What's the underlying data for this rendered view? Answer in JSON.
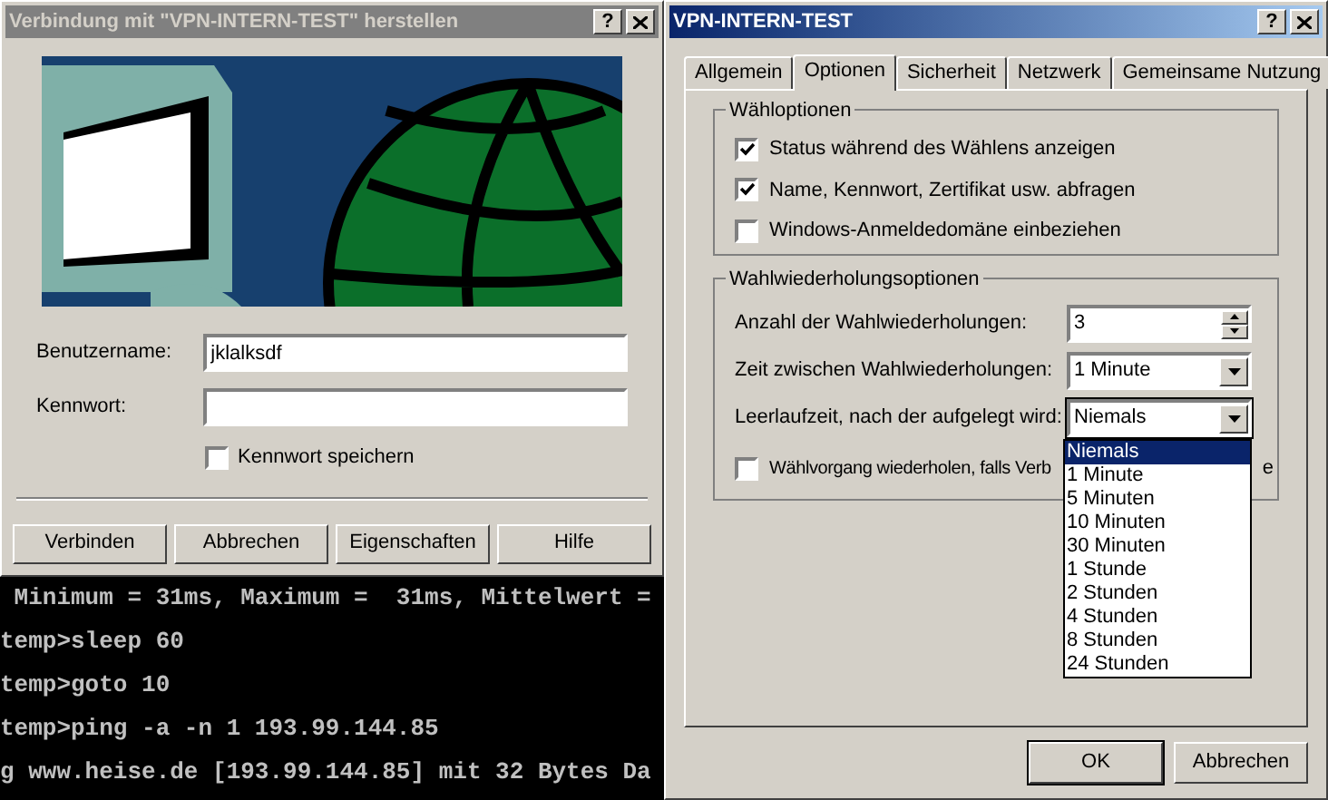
{
  "login_dialog": {
    "title": "Verbindung mit \"VPN-INTERN-TEST\" herstellen",
    "help_button": "?",
    "fields": [
      {
        "label": "Benutzername:",
        "value": "jklalksdf"
      },
      {
        "label": "Kennwort:"
      }
    ],
    "save_password": {
      "label": "Kennwort speichern",
      "checked": false
    },
    "buttons": [
      "Verbinden",
      "Abbrechen",
      "Eigenschaften",
      "Hilfe"
    ]
  },
  "console": {
    "lines": [
      " Minimum = 31ms, Maximum =  31ms, Mittelwert =",
      "temp>sleep 60",
      "temp>goto 10",
      "temp>ping -a -n 1 193.99.144.85",
      "g www.heise.de [193.99.144.85] mit 32 Bytes Da"
    ]
  },
  "properties_dialog": {
    "title": "VPN-INTERN-TEST",
    "help_button": "?",
    "tabs": [
      {
        "label": "Allgemein",
        "selected": false
      },
      {
        "label": "Optionen",
        "selected": true
      },
      {
        "label": "Sicherheit",
        "selected": false
      },
      {
        "label": "Netzwerk",
        "selected": false
      },
      {
        "label": "Gemeinsame Nutzung",
        "selected": false
      }
    ],
    "dial_options": {
      "title": "Wähloptionen",
      "checkboxes": [
        {
          "label": "Status während des Wählens anzeigen",
          "checked": true
        },
        {
          "label": "Name, Kennwort, Zertifikat usw. abfragen",
          "checked": true
        },
        {
          "label": "Windows-Anmeldedomäne einbeziehen",
          "checked": false
        }
      ]
    },
    "redial_options": {
      "title": "Wahlwiederholungsoptionen",
      "rows": [
        {
          "kind": "spinner",
          "label": "Anzahl der Wahlwiederholungen:",
          "value": "3"
        },
        {
          "kind": "dropdown",
          "label": "Zeit zwischen Wahlwiederholungen:",
          "value": "1 Minute",
          "expanded": false
        },
        {
          "kind": "dropdown",
          "label": "Leerlaufzeit, nach der aufgelegt wird:",
          "value": "Niemals",
          "expanded": true,
          "options": [
            {
              "label": "Niemals",
              "selected": true
            },
            {
              "label": "1 Minute",
              "selected": false
            },
            {
              "label": "5 Minuten",
              "selected": false
            },
            {
              "label": "10 Minuten",
              "selected": false
            },
            {
              "label": "30 Minuten",
              "selected": false
            },
            {
              "label": "1 Stunde",
              "selected": false
            },
            {
              "label": "2 Stunden",
              "selected": false
            },
            {
              "label": "4 Stunden",
              "selected": false
            },
            {
              "label": "8 Stunden",
              "selected": false
            },
            {
              "label": "24 Stunden",
              "selected": false
            }
          ]
        }
      ],
      "redial_checkbox": {
        "label": "Wählvorgang wiederholen, falls Verb",
        "label_tail": "e",
        "checked": false
      }
    },
    "buttons": [
      {
        "label": "OK",
        "default": true
      },
      {
        "label": "Abbrechen",
        "default": false
      }
    ]
  }
}
